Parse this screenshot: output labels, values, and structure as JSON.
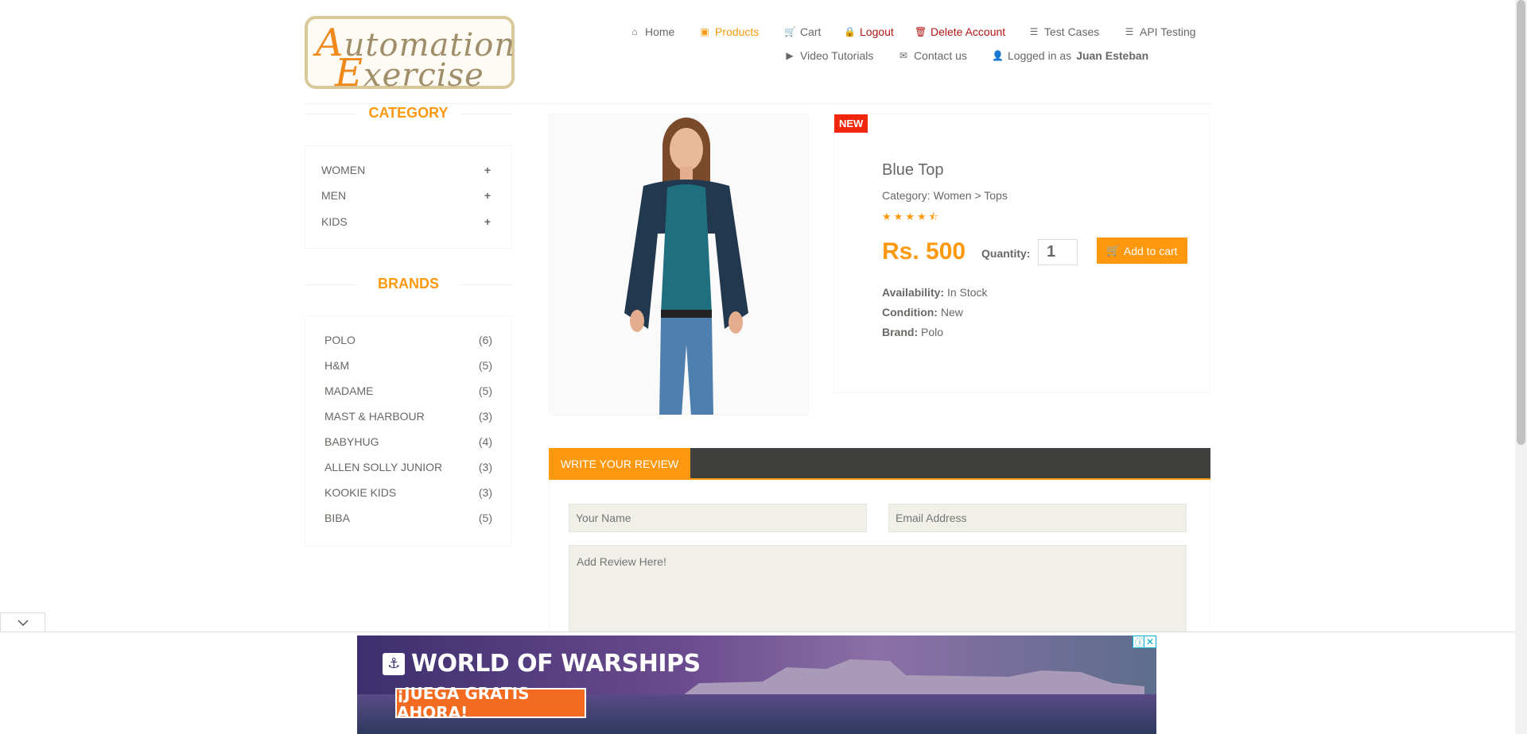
{
  "logo": {
    "line1_cap": "A",
    "line1_rest": "utomation",
    "line2_cap": "E",
    "line2_rest": "xercise"
  },
  "nav": {
    "home": "Home",
    "products": "Products",
    "cart": "Cart",
    "logout": "Logout",
    "delete_account": "Delete Account",
    "test_cases": "Test Cases",
    "api_testing": "API Testing",
    "video_tutorials": "Video Tutorials",
    "contact_us": "Contact us",
    "logged_in_prefix": "Logged in as",
    "user_name": "Juan Esteban"
  },
  "sidebar": {
    "category_title": "CATEGORY",
    "categories": [
      {
        "label": "WOMEN"
      },
      {
        "label": "MEN"
      },
      {
        "label": "KIDS"
      }
    ],
    "brands_title": "BRANDS",
    "brands": [
      {
        "label": "POLO",
        "count": "(6)"
      },
      {
        "label": "H&M",
        "count": "(5)"
      },
      {
        "label": "MADAME",
        "count": "(5)"
      },
      {
        "label": "MAST & HARBOUR",
        "count": "(3)"
      },
      {
        "label": "BABYHUG",
        "count": "(4)"
      },
      {
        "label": "ALLEN SOLLY JUNIOR",
        "count": "(3)"
      },
      {
        "label": "KOOKIE KIDS",
        "count": "(3)"
      },
      {
        "label": "BIBA",
        "count": "(5)"
      }
    ]
  },
  "product": {
    "badge": "NEW",
    "title": "Blue Top",
    "category": "Category: Women > Tops",
    "rating": 4.5,
    "price": "Rs. 500",
    "quantity_label": "Quantity:",
    "quantity_value": "1",
    "add_to_cart": "Add to cart",
    "availability_label": "Availability:",
    "availability_value": "In Stock",
    "condition_label": "Condition:",
    "condition_value": "New",
    "brand_label": "Brand:",
    "brand_value": "Polo"
  },
  "review": {
    "tab": "WRITE YOUR REVIEW",
    "name_placeholder": "Your Name",
    "email_placeholder": "Email Address",
    "review_placeholder": "Add Review Here!"
  },
  "ad": {
    "title": "WORLD OF WARSHIPS",
    "button": "¡JUEGA GRATIS AHORA!",
    "info": "ⓘ",
    "close": "✕"
  },
  "colors": {
    "accent": "#fe980f",
    "danger": "#b41515",
    "badge": "#f1260a",
    "review_bar": "#40403e"
  }
}
